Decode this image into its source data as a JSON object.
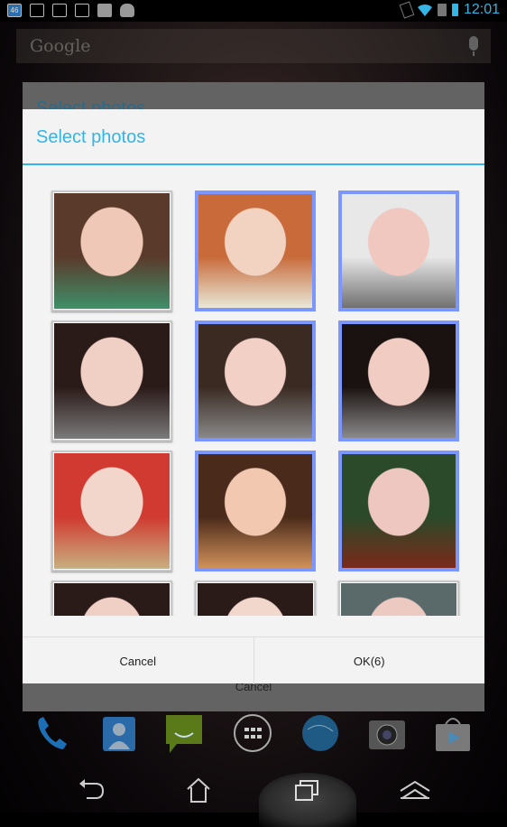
{
  "status_bar": {
    "notifications": [
      "signal-46-icon",
      "gallery-icon",
      "gmail-icon",
      "battery-saver-icon",
      "sd-card-icon",
      "android-icon"
    ],
    "system": [
      "rotate-lock-icon",
      "wifi-icon",
      "sim-unknown-icon",
      "battery-charging-icon"
    ],
    "time": "12:01"
  },
  "search_bar": {
    "placeholder": "Google",
    "icon": "mic-icon"
  },
  "background_dialog": {
    "title": "Select photos",
    "cancel_label": "Cancel"
  },
  "dialog": {
    "title": "Select photos",
    "photos": [
      {
        "selected": false,
        "colors": [
          "#5a3a2a",
          "#f0c8b8",
          "#3f8f6a"
        ]
      },
      {
        "selected": true,
        "colors": [
          "#c86a3a",
          "#f2d2c0",
          "#e8e8d8"
        ]
      },
      {
        "selected": true,
        "colors": [
          "#e8e8e8",
          "#f0c8c0",
          "#707070"
        ]
      },
      {
        "selected": false,
        "colors": [
          "#2a1a18",
          "#f0cfc4",
          "#7a7a7a"
        ]
      },
      {
        "selected": true,
        "colors": [
          "#3a2a22",
          "#f2d0c6",
          "#888888"
        ]
      },
      {
        "selected": true,
        "colors": [
          "#1a1210",
          "#f0ccc2",
          "#8a8a8a"
        ]
      },
      {
        "selected": false,
        "colors": [
          "#d03a30",
          "#f2d6cc",
          "#c8b080"
        ]
      },
      {
        "selected": true,
        "colors": [
          "#4a2a1a",
          "#f2c8b0",
          "#d0905a"
        ]
      },
      {
        "selected": true,
        "colors": [
          "#2a4a2a",
          "#eec8c0",
          "#7a2a1a"
        ]
      },
      {
        "selected": false,
        "colors": [
          "#2a1a18",
          "#f0cfc4",
          "#f0cfc4"
        ]
      },
      {
        "selected": false,
        "colors": [
          "#2a1a18",
          "#f2d8cc",
          "#e8e0b0"
        ]
      },
      {
        "selected": false,
        "colors": [
          "#5a6a6a",
          "#eccac2",
          "#f0d0c8"
        ]
      }
    ],
    "cancel_label": "Cancel",
    "ok_label": "OK(6)",
    "selected_count": 6
  },
  "dock": {
    "apps": [
      "phone-icon",
      "contacts-icon",
      "messaging-icon",
      "app-drawer-icon",
      "browser-icon",
      "camera-icon",
      "play-store-icon"
    ]
  },
  "nav_bar": {
    "buttons": [
      "back-icon",
      "home-icon",
      "recent-apps-icon",
      "menu-up-icon"
    ]
  }
}
